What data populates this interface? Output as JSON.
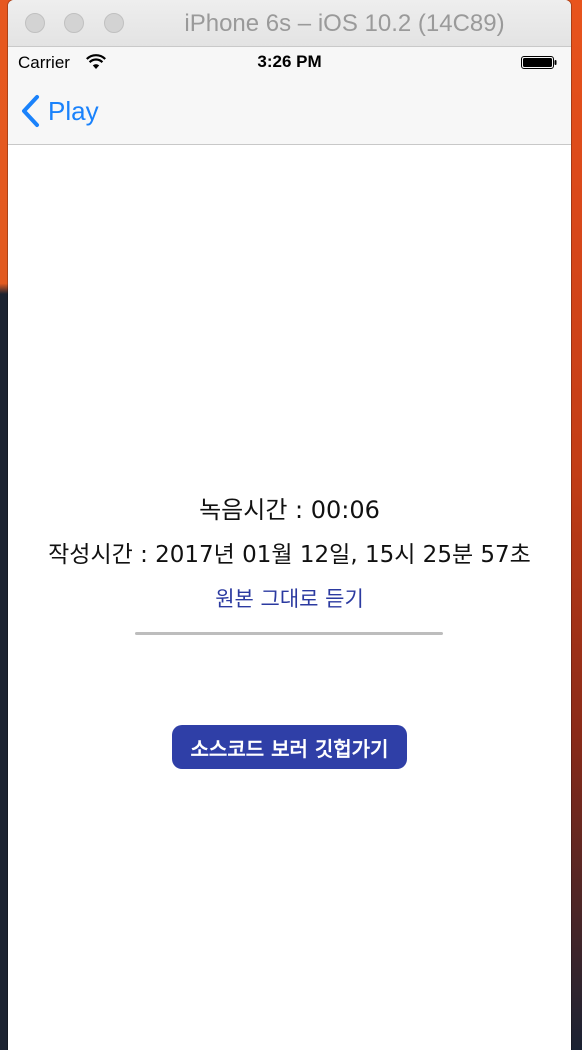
{
  "window": {
    "title": "iPhone 6s – iOS 10.2 (14C89)"
  },
  "status_bar": {
    "carrier": "Carrier",
    "time": "3:26 PM"
  },
  "nav": {
    "back_label": "Play"
  },
  "recording": {
    "duration": "녹음시간 : 00:06",
    "created_at": "작성시간 : 2017년 01월 12일, 15시 25분 57초",
    "listen_original": "원본 그대로 듣기",
    "progress": 0
  },
  "actions": {
    "github_button": "소스코드 보러 깃헙가기"
  },
  "colors": {
    "tint": "#1a82fb",
    "button_bg": "#2f3fa7",
    "link": "#2b3aa0"
  }
}
